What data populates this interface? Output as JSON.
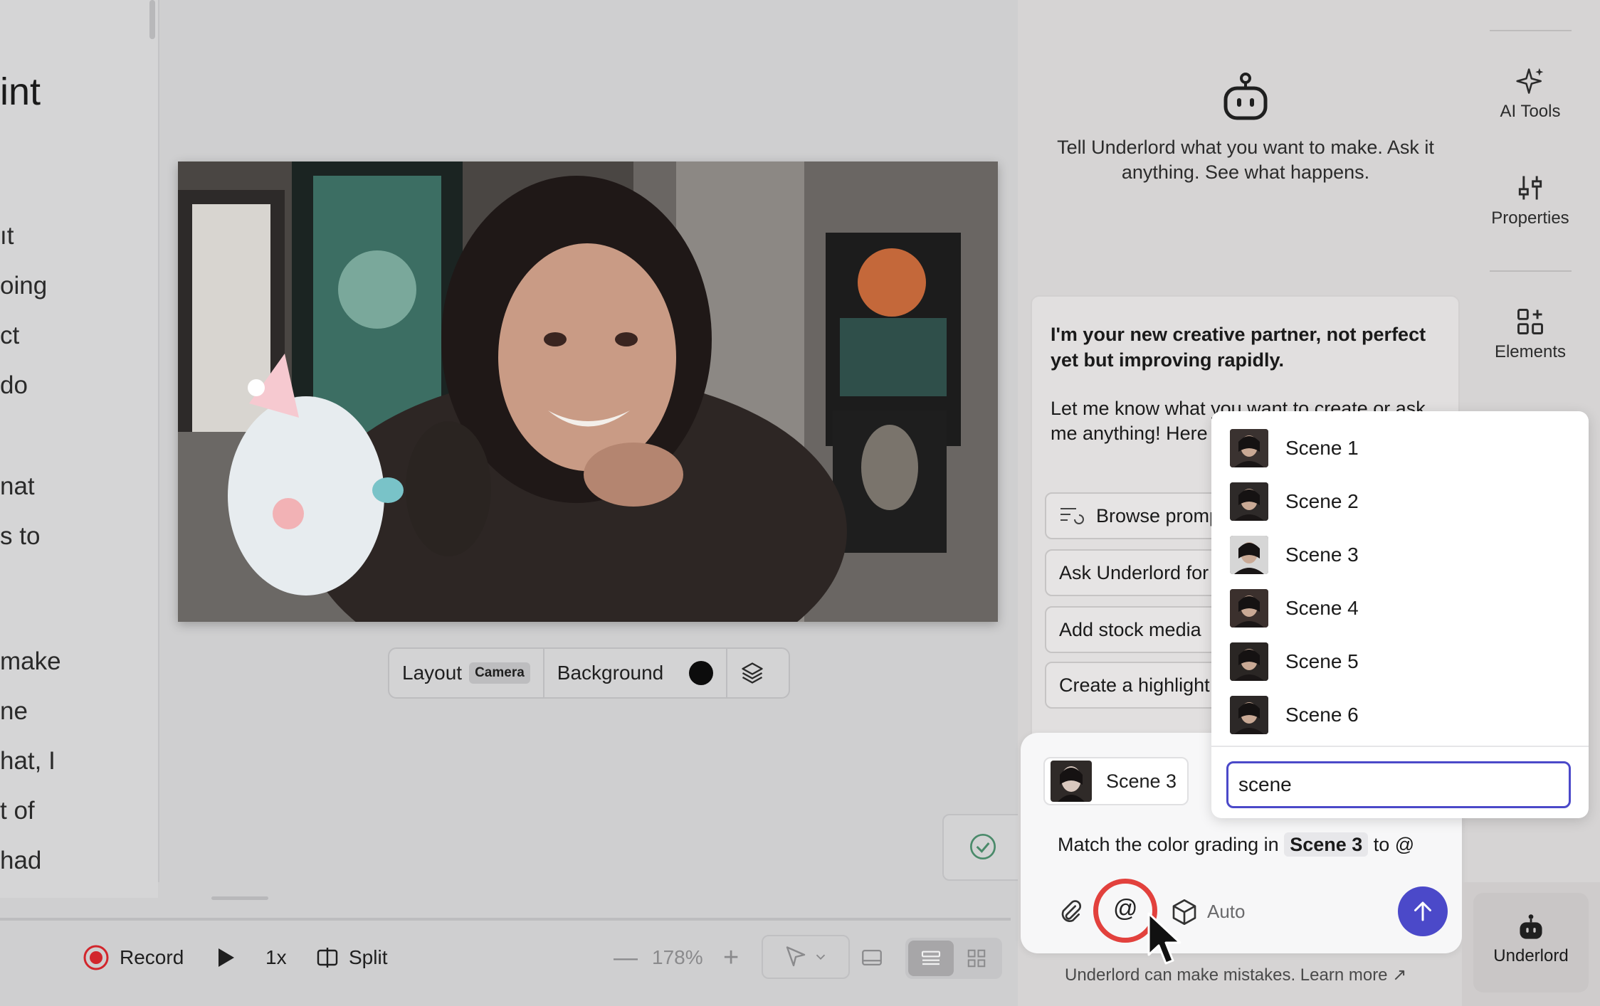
{
  "script": {
    "heading": "int",
    "lines": [
      "ıt",
      "oing",
      "ct",
      " do",
      "nat",
      "s to",
      "make",
      "ne",
      "hat, I",
      "t of",
      "had"
    ]
  },
  "stage": {
    "layout_label": "Layout",
    "layout_value": "Camera",
    "background_label": "Background"
  },
  "controls": {
    "record_label": "Record",
    "speed_label": "1x",
    "split_label": "Split",
    "zoom_value": "178%"
  },
  "right_rail": {
    "ai_tools": "AI Tools",
    "properties": "Properties",
    "elements": "Elements",
    "underlord": "Underlord"
  },
  "underlord": {
    "intro": "Tell Underlord what you want to make. Ask it anything. See what happens.",
    "chat_title": "I'm your new creative partner, not perfect yet but improving rapidly.",
    "chat_body": "Let me know what you want to create or ask me anything! Here are some ways I can help:",
    "prompts": [
      "Browse prompts",
      "Ask Underlord for ideas",
      "Add stock media",
      "Create a highlight"
    ],
    "attached_scene": "Scene 3",
    "message_prefix": "Match the color grading in",
    "message_tag": "Scene 3",
    "message_suffix": "to @",
    "model_label": "Auto",
    "disclaimer": "Underlord can make mistakes. Learn more ↗"
  },
  "dropdown": {
    "scenes": [
      "Scene 1",
      "Scene 2",
      "Scene 3",
      "Scene 4",
      "Scene 5",
      "Scene 6"
    ],
    "search_value": "scene"
  },
  "colors": {
    "accent": "#4b49c9",
    "highlight_ring": "#e2413d",
    "record_red": "#d2262c"
  }
}
